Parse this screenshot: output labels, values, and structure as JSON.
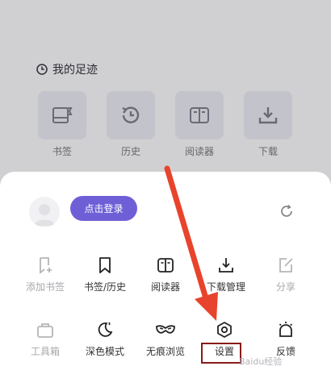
{
  "background": {
    "section_title": "我的足迹",
    "items": [
      {
        "label": "书签",
        "icon": "bookmark-icon"
      },
      {
        "label": "历史",
        "icon": "history-icon"
      },
      {
        "label": "阅读器",
        "icon": "reader-icon"
      },
      {
        "label": "下载",
        "icon": "download-icon"
      }
    ]
  },
  "sheet": {
    "login_label": "点击登录",
    "menu": [
      {
        "label": "添加书签",
        "disabled": true
      },
      {
        "label": "书签/历史",
        "disabled": false
      },
      {
        "label": "阅读器",
        "disabled": false
      },
      {
        "label": "下载管理",
        "disabled": false
      },
      {
        "label": "分享",
        "disabled": true
      },
      {
        "label": "工具箱",
        "disabled": true
      },
      {
        "label": "深色模式",
        "disabled": false
      },
      {
        "label": "无痕浏览",
        "disabled": false
      },
      {
        "label": "设置",
        "disabled": false
      },
      {
        "label": "反馈",
        "disabled": false
      }
    ]
  },
  "colors": {
    "accent": "#6f5fd7",
    "highlight_box": "#8b1a1a",
    "arrow": "#e8432c"
  },
  "watermark": "Baidu经验"
}
